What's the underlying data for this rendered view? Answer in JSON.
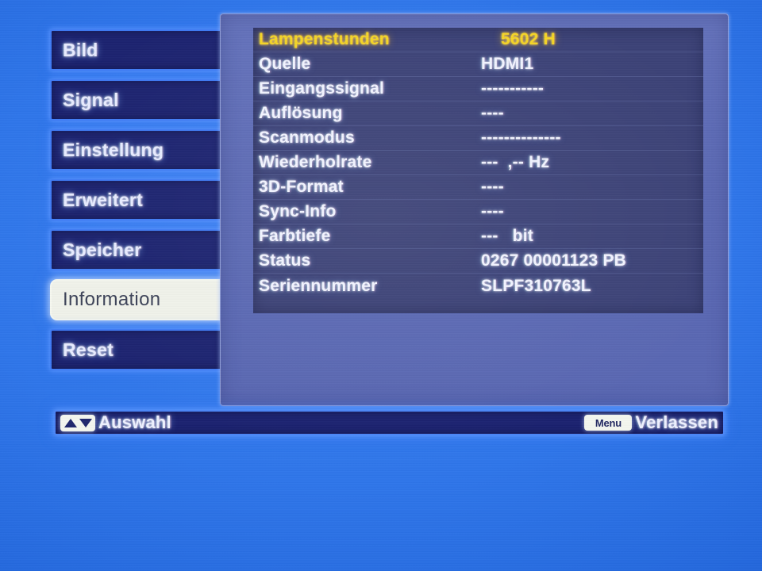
{
  "colors": {
    "background_blue": "#2f76ea",
    "menu_fill": "#1c2370",
    "menu_border": "#3f7bf5",
    "menu_text": "#e8ecff",
    "selected_fill": "#f0f2ea",
    "selected_text": "#3c4257",
    "panel_fill": "#5b69b4",
    "panel_inner_fill": "#3c4277",
    "value_text": "#f2f4ff",
    "highlight_yellow": "#f5d525"
  },
  "sidebar": {
    "items": [
      {
        "label": "Bild",
        "selected": false
      },
      {
        "label": "Signal",
        "selected": false
      },
      {
        "label": "Einstellung",
        "selected": false
      },
      {
        "label": "Erweitert",
        "selected": false
      },
      {
        "label": "Speicher",
        "selected": false
      },
      {
        "label": "Information",
        "selected": true
      },
      {
        "label": "Reset",
        "selected": false
      }
    ]
  },
  "panel": {
    "rows": [
      {
        "label": "Lampenstunden",
        "value": "5602 H",
        "highlight": true
      },
      {
        "label": "Quelle",
        "value": "HDMI1",
        "highlight": false
      },
      {
        "label": "Eingangssignal",
        "value": "-----------",
        "highlight": false
      },
      {
        "label": "Auflösung",
        "value": "----",
        "highlight": false
      },
      {
        "label": "Scanmodus",
        "value": "--------------",
        "highlight": false
      },
      {
        "label": "Wiederholrate",
        "value": "---  ,-- Hz",
        "highlight": false
      },
      {
        "label": "3D-Format",
        "value": "----",
        "highlight": false
      },
      {
        "label": "Sync-Info",
        "value": "----",
        "highlight": false
      },
      {
        "label": "Farbtiefe",
        "value": "---   bit",
        "highlight": false
      },
      {
        "label": "Status",
        "value": "0267 00001123 PB",
        "highlight": false
      },
      {
        "label": "Seriennummer",
        "value": "SLPF310763L",
        "highlight": false
      }
    ]
  },
  "hintbar": {
    "select_hint": "Auswahl",
    "select_key_icon": "up-down-arrows-icon",
    "exit_key_label": "Menu",
    "exit_hint": "Verlassen"
  }
}
